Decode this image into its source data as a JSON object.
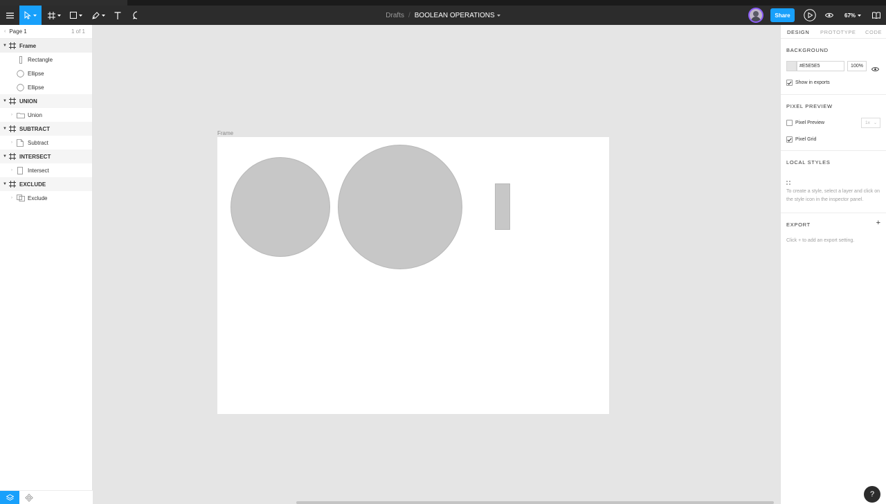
{
  "toolbar": {
    "breadcrumb_parent": "Drafts",
    "breadcrumb_separator": "/",
    "file_name": "BOOLEAN OPERATIONS",
    "share_label": "Share",
    "zoom_label": "67%",
    "icons": [
      "menu-icon",
      "move-icon",
      "frame-icon",
      "rectangle-icon",
      "pen-icon",
      "text-icon",
      "comment-icon",
      "avatar",
      "play-icon",
      "eye-icon",
      "book-icon"
    ]
  },
  "layers": {
    "page_name": "Page 1",
    "page_count": "1 of 1",
    "rows": [
      {
        "name": "Frame",
        "kind": "frame"
      },
      {
        "name": "Rectangle",
        "kind": "rectangle"
      },
      {
        "name": "Ellipse",
        "kind": "ellipse"
      },
      {
        "name": "Ellipse",
        "kind": "ellipse"
      },
      {
        "name": "UNION",
        "kind": "frame"
      },
      {
        "name": "Union",
        "kind": "boolean"
      },
      {
        "name": "SUBTRACT",
        "kind": "frame"
      },
      {
        "name": "Subtract",
        "kind": "boolean"
      },
      {
        "name": "INTERSECT",
        "kind": "frame"
      },
      {
        "name": "Intersect",
        "kind": "boolean"
      },
      {
        "name": "EXCLUDE",
        "kind": "frame"
      },
      {
        "name": "Exclude",
        "kind": "boolean"
      }
    ]
  },
  "canvas": {
    "frame_label": "Frame",
    "frame_fill": "#FFFFFF",
    "shape_fill": "#C7C7C7"
  },
  "inspector": {
    "tabs": [
      "DESIGN",
      "PROTOTYPE",
      "CODE"
    ],
    "active_tab": "DESIGN",
    "background": {
      "title": "BACKGROUND",
      "color_hex": "#E5E5E5",
      "opacity": "100%",
      "show_in_exports_label": "Show in exports",
      "show_in_exports": true
    },
    "pixel_preview": {
      "title": "PIXEL PREVIEW",
      "pixel_preview_label": "Pixel Preview",
      "pixel_preview": false,
      "scale_value": "1x",
      "pixel_grid_label": "Pixel Grid",
      "pixel_grid": true
    },
    "local_styles": {
      "title": "LOCAL STYLES",
      "hint": "To create a style, select a layer and click on the style icon in the inspector panel."
    },
    "export": {
      "title": "EXPORT",
      "add_symbol": "+",
      "hint": "Click + to add an export setting."
    }
  },
  "help_label": "?",
  "colors": {
    "accent": "#18A0FB",
    "toolbar_bg": "#2C2C2C",
    "canvas_bg": "#E5E5E5",
    "avatar_ring": "#8B5CF6"
  }
}
